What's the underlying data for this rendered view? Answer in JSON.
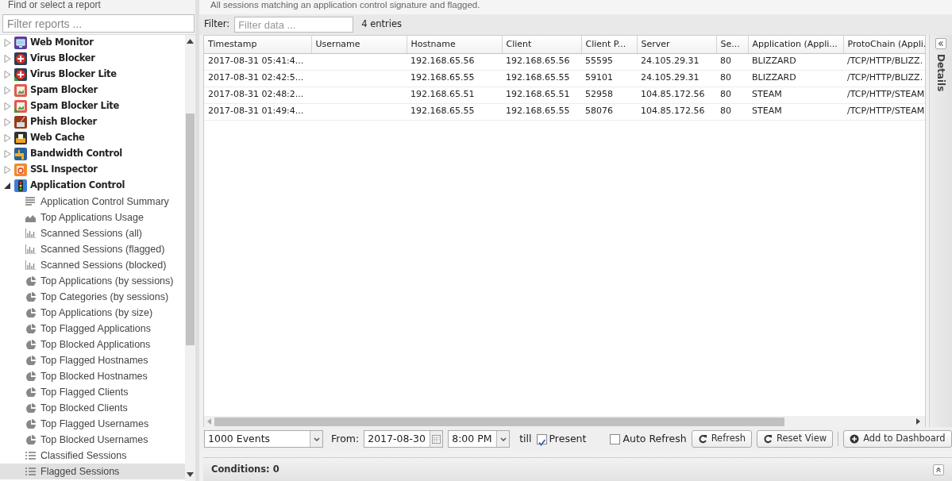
{
  "sidebar": {
    "title": "Find or select a report",
    "filter": {
      "placeholder": "Filter reports ..."
    },
    "items": [
      {
        "label": "Web Monitor",
        "kind": "monitor",
        "expanded": false,
        "selected": false
      },
      {
        "label": "Virus Blocker",
        "kind": "virus",
        "expanded": false,
        "selected": false
      },
      {
        "label": "Virus Blocker Lite",
        "kind": "virus-lite",
        "expanded": false,
        "selected": false
      },
      {
        "label": "Spam Blocker",
        "kind": "spam",
        "expanded": false,
        "selected": false
      },
      {
        "label": "Spam Blocker Lite",
        "kind": "spam-lite",
        "expanded": false,
        "selected": false
      },
      {
        "label": "Phish Blocker",
        "kind": "phish",
        "expanded": false,
        "selected": false
      },
      {
        "label": "Web Cache",
        "kind": "cache",
        "expanded": false,
        "selected": false
      },
      {
        "label": "Bandwidth Control",
        "kind": "tap",
        "expanded": false,
        "selected": false
      },
      {
        "label": "SSL Inspector",
        "kind": "ssl",
        "expanded": false,
        "selected": false
      },
      {
        "label": "Application Control",
        "kind": "lights",
        "expanded": true,
        "selected": false,
        "children": [
          {
            "label": "Application Control Summary",
            "kind": "text",
            "selected": false
          },
          {
            "label": "Top Applications Usage",
            "kind": "area",
            "selected": false
          },
          {
            "label": "Scanned Sessions (all)",
            "kind": "bar",
            "selected": false
          },
          {
            "label": "Scanned Sessions (flagged)",
            "kind": "bar",
            "selected": false
          },
          {
            "label": "Scanned Sessions (blocked)",
            "kind": "bar",
            "selected": false
          },
          {
            "label": "Top Applications (by sessions)",
            "kind": "pie",
            "selected": false
          },
          {
            "label": "Top Categories (by sessions)",
            "kind": "pie",
            "selected": false
          },
          {
            "label": "Top Applications (by size)",
            "kind": "pie",
            "selected": false
          },
          {
            "label": "Top Flagged Applications",
            "kind": "pie",
            "selected": false
          },
          {
            "label": "Top Blocked Applications",
            "kind": "pie",
            "selected": false
          },
          {
            "label": "Top Flagged Hostnames",
            "kind": "pie",
            "selected": false
          },
          {
            "label": "Top Blocked Hostnames",
            "kind": "pie",
            "selected": false
          },
          {
            "label": "Top Flagged Clients",
            "kind": "pie",
            "selected": false
          },
          {
            "label": "Top Blocked Clients",
            "kind": "pie",
            "selected": false
          },
          {
            "label": "Top Flagged Usernames",
            "kind": "pie",
            "selected": false
          },
          {
            "label": "Top Blocked Usernames",
            "kind": "pie",
            "selected": false
          },
          {
            "label": "Classified Sessions",
            "kind": "list",
            "selected": false
          },
          {
            "label": "Flagged Sessions",
            "kind": "list",
            "selected": true
          }
        ]
      }
    ]
  },
  "report": {
    "description": "All sessions matching an application control signature and flagged.",
    "filter": {
      "label": "Filter:",
      "placeholder": "Filter data ...",
      "count": "4 entries"
    },
    "table": {
      "columns": [
        "Timestamp",
        "Username",
        "Hostname",
        "Client",
        "Client P...",
        "Server",
        "Se...",
        "Application (Appli...",
        "ProtoChain (Appli."
      ],
      "rows": [
        [
          "2017-08-31 05:41:4...",
          null,
          "192.168.65.56",
          "192.168.65.56",
          "55595",
          "24.105.29.31",
          "80",
          "BLIZZARD",
          "/TCP/HTTP/BLIZZ."
        ],
        [
          "2017-08-31 02:42:5...",
          null,
          "192.168.65.55",
          "192.168.65.55",
          "59101",
          "24.105.29.31",
          "80",
          "BLIZZARD",
          "/TCP/HTTP/BLIZZ."
        ],
        [
          "2017-08-31 02:48:2...",
          null,
          "192.168.65.51",
          "192.168.65.51",
          "52958",
          "104.85.172.56",
          "80",
          "STEAM",
          "/TCP/HTTP/STEAM"
        ],
        [
          "2017-08-31 01:49:4...",
          null,
          "192.168.65.55",
          "192.168.65.55",
          "58076",
          "104.85.172.56",
          "80",
          "STEAM",
          "/TCP/HTTP/STEAM"
        ]
      ]
    },
    "toolbar": {
      "limit": "1000 Events",
      "from_label": "From:",
      "date": "2017-08-30",
      "time": "8:00 PM",
      "till_label": "till",
      "present": {
        "label": "Present",
        "checked": true
      },
      "auto_refresh": {
        "label": "Auto Refresh",
        "checked": false
      },
      "buttons": [
        {
          "label": "Refresh",
          "kind": "refresh"
        },
        {
          "label": "Reset View",
          "kind": "refresh"
        },
        {
          "label": "Add to Dashboard",
          "kind": "add"
        }
      ]
    },
    "conditions": "Conditions: 0"
  },
  "details_panel": {
    "title": "Details"
  }
}
